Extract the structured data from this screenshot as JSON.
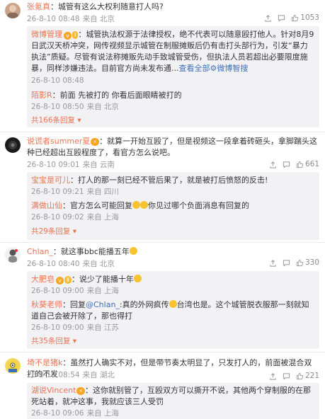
{
  "thread1": {
    "comment": {
      "user": "张氪真",
      "text": "：城管有这么大权利随意打人吗?",
      "date": "26-8-10 08:48",
      "source": "来自 北京"
    },
    "actions": {
      "like_count": "1053"
    },
    "replies": [
      {
        "user": "微博管理",
        "text_a": "：城管执法权源于法律授权，绝不代表可以随意殴打他人。针对8月9日武汉天桥冲突，网传视频显示城管在制服摊贩后仍有击打头部行为，引发“暴力执法”质疑。尽管有说法称摊贩先动手致城管受伤，但执法人员若超出必要限度施暴，同样涉嫌违法。目前官方尚未发布通...",
        "more_link": "查看全部",
        "ai_suffix": "微博智搜",
        "date": "26-8-10 08:48",
        "source": ""
      },
      {
        "user": "陌影R",
        "text": "：前面 先被打的 你看后面眼睛被打的",
        "date": "26-8-10 08:50",
        "source": "来自 北京"
      }
    ],
    "more_replies": "共166条回复"
  },
  "thread2": {
    "comment": {
      "user": "说谎者summer夏",
      "text": "：就算一开始互殴了，但是视频这一段拿着砖砸头，拿脚踹头这种已经超出互殴程度了，看官方怎么说吧。",
      "date": "26-8-10 09:01",
      "source": "来自 云南"
    },
    "actions": {
      "like_count": "661"
    },
    "replies": [
      {
        "user": "宝宝是可儿",
        "text": "：打人的那一刻已经不管后果了，就是被打后愤怒的反击!",
        "date": "26-8-10 09:21",
        "source": "来自 四川"
      },
      {
        "user": "满做山仙",
        "text_a": "：官方怎么可能回复",
        "text_b": "你见过哪个负面消息有回复的",
        "date": "26-8-10 09:02",
        "source": "来自 上海"
      }
    ],
    "more_replies": "共29条回复"
  },
  "thread3": {
    "comment": {
      "user": "Chlan_",
      "text": "：就这事bbc能播五年",
      "date": "26-8-10 08:40",
      "source": "来自 北京"
    },
    "actions": {
      "like_count": "330"
    },
    "replies": [
      {
        "user": "大肥皂",
        "text": "：说少了能播十年",
        "date": "26-8-10 09:00",
        "source": "来自 上海"
      },
      {
        "user": "秋葵老师",
        "text_a": "：回复",
        "mention": "@Chlan_",
        "text_b": ":真的外网疯传",
        "text_c": "台湾也是。这个城管脱衣服那一刻就知道自己会被开除了，那也得打",
        "date": "26-8-10 09:00",
        "source": "来自 江苏"
      }
    ],
    "more_replies": "共35条回复"
  },
  "thread4": {
    "comment": {
      "user": "埼不是猪k",
      "text": "：虽然打人确实不对，但是带节奏太明显了，只发打人的，前面被混合双打的不发",
      "date": "26-8-10 08:54",
      "source": "来自 湖北"
    },
    "actions": {
      "like_count": "221"
    },
    "replies": [
      {
        "user": "湖说Vincent",
        "text": "：这你就别管了，互殴双方可以撕开不说，其他两个穿制服的在那死站着，就冲这事，我就应该三人受罚",
        "date": "26-8-10 09:06",
        "source": "来自 上海"
      }
    ]
  },
  "icons": [
    "share-icon",
    "comment-icon",
    "like-icon",
    "verified-icon",
    "level-badge",
    "emoji"
  ]
}
